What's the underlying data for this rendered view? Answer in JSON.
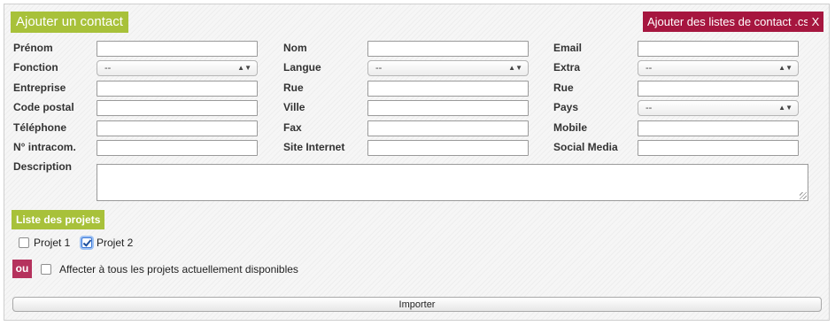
{
  "form": {
    "title": "Ajouter un contact",
    "csv_button": "Ajouter des listes de contact .csv",
    "close_button": "X",
    "select_placeholder": "--",
    "fields": {
      "prenom": "Prénom",
      "nom": "Nom",
      "email": "Email",
      "fonction": "Fonction",
      "langue": "Langue",
      "extra": "Extra",
      "entreprise": "Entreprise",
      "rue1": "Rue",
      "rue2": "Rue",
      "code_postal": "Code postal",
      "ville": "Ville",
      "pays": "Pays",
      "telephone": "Téléphone",
      "fax": "Fax",
      "mobile": "Mobile",
      "intracom": "N° intracom.",
      "site_internet": "Site Internet",
      "social_media": "Social Media",
      "description": "Description"
    }
  },
  "projects": {
    "title": "Liste des projets",
    "items": [
      {
        "label": "Projet 1",
        "checked": false
      },
      {
        "label": "Projet 2",
        "checked": true
      }
    ],
    "or_label": "ou",
    "assign_all_label": "Affecter à tous les projets actuellement disponibles",
    "assign_all_checked": false
  },
  "import_button": "Importer",
  "colors": {
    "accent_green": "#a8c13a",
    "accent_red": "#a6163f",
    "or_badge": "#b5325d"
  }
}
